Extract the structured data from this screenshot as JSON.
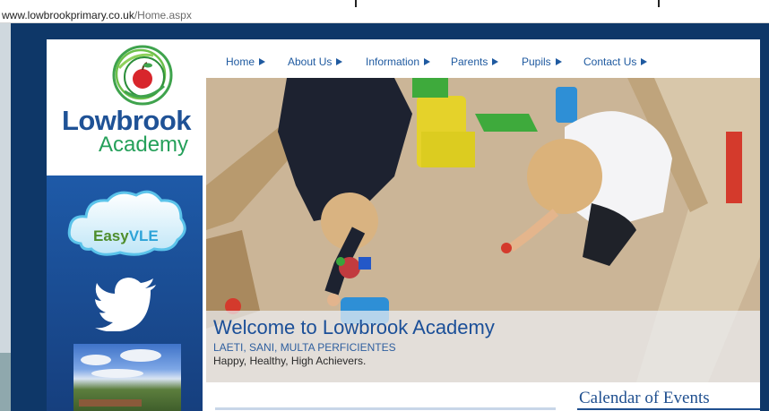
{
  "browser": {
    "url_domain": "www.lowbrookprimary.co.uk",
    "url_path": "/Home.aspx"
  },
  "logo": {
    "name": "Lowbrook",
    "subtitle": "Academy",
    "icon": "apple-tree-icon"
  },
  "sidebar": {
    "vle": {
      "prefix": "Easy",
      "suffix": "VLE",
      "icon": "cloud-icon"
    },
    "twitter": {
      "icon": "twitter-bird-icon"
    },
    "photo": {
      "icon": "school-building-photo"
    }
  },
  "nav": {
    "items": [
      {
        "label": "Home"
      },
      {
        "label": "About Us"
      },
      {
        "label": "Information"
      },
      {
        "label": "Parents"
      },
      {
        "label": "Pupils"
      },
      {
        "label": "Contact Us"
      }
    ]
  },
  "hero": {
    "title": "Welcome to Lowbrook Academy",
    "motto": "LAETI, SANI, MULTA PERFICIENTES",
    "tagline": "Happy, Healthy, High Achievers."
  },
  "calendar": {
    "heading": "Calendar of Events"
  },
  "colors": {
    "page_bg": "#0e3768",
    "brand_blue": "#1f5296",
    "brand_green": "#25a05a",
    "nav_blue": "#1f5aa0"
  }
}
